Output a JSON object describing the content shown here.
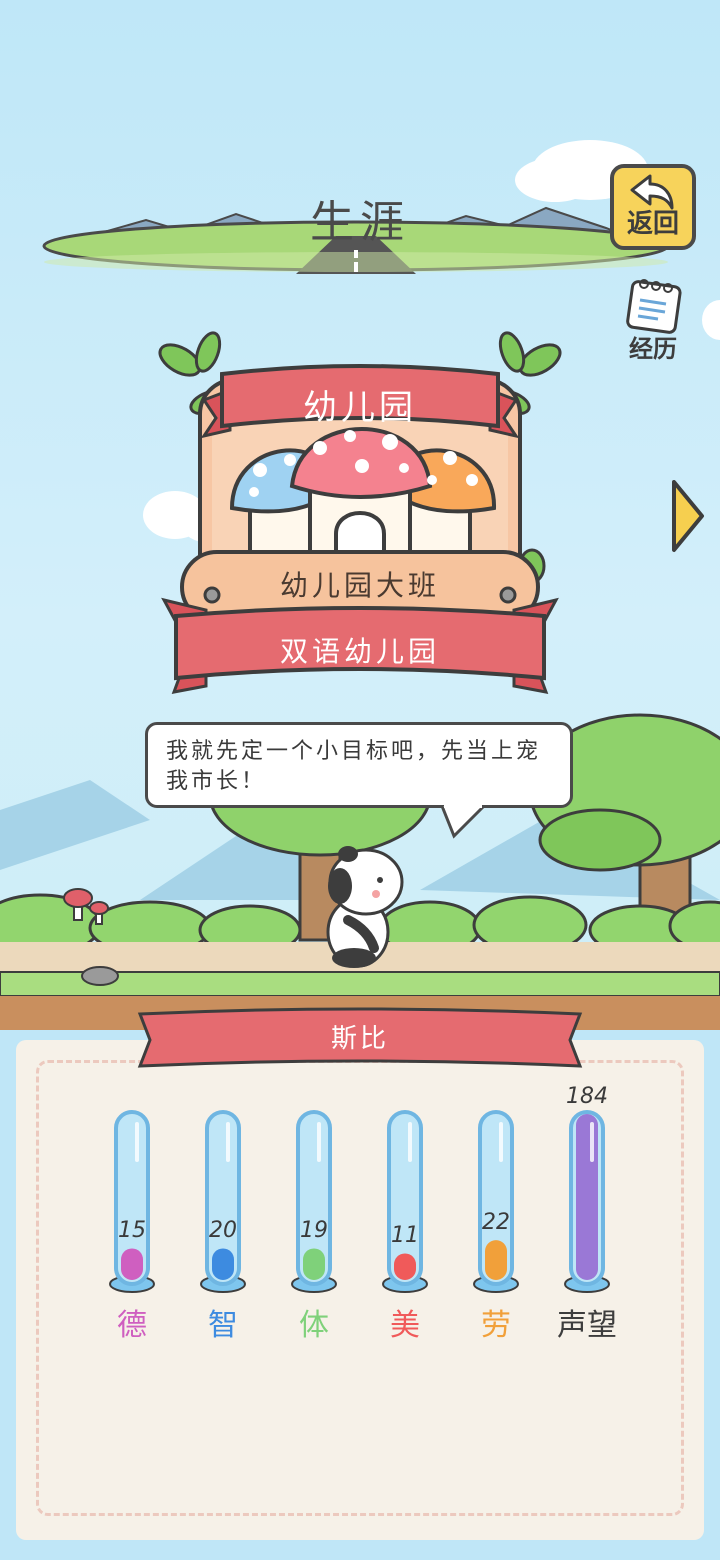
{
  "header": {
    "title": "生涯",
    "back_label": "返回",
    "history_label": "经历"
  },
  "stage": {
    "school": "幼儿园",
    "class": "幼儿园大班",
    "school_name": "双语幼儿园"
  },
  "dialogue": "我就先定一个小目标吧，先当上宠我市长！",
  "character": {
    "name": "斯比"
  },
  "stats": [
    {
      "label": "德",
      "value": "15",
      "level": 0.19,
      "color": "#cf5fc0"
    },
    {
      "label": "智",
      "value": "20",
      "level": 0.19,
      "color": "#3d8be0"
    },
    {
      "label": "体",
      "value": "19",
      "level": 0.19,
      "color": "#7fd17a"
    },
    {
      "label": "美",
      "value": "11",
      "level": 0.16,
      "color": "#f05a5a"
    },
    {
      "label": "劳",
      "value": "22",
      "level": 0.24,
      "color": "#f1a03a"
    },
    {
      "label": "声望",
      "value": "184",
      "level": 1.0,
      "color": "#9a78d6"
    }
  ],
  "icons": [
    "back-arrow-icon",
    "notebook-icon",
    "right-arrow-icon",
    "mushroom-house-icon",
    "panda-icon"
  ]
}
